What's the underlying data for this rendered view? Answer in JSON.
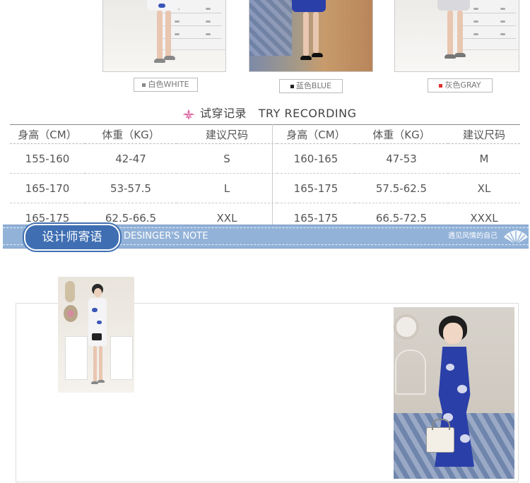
{
  "colors": {
    "white_dress": "#f4f4f6",
    "blue_dress": "#2a3fa8",
    "gray_dress": "#d9d9dd",
    "banner": "#92b2d8",
    "pill": "#3f6fb2",
    "fleur": "#e06aa6"
  },
  "swatches": [
    {
      "label": "白色WHITE",
      "dot_color": "#888888"
    },
    {
      "label": "蓝色BLUE",
      "dot_color": "#222222"
    },
    {
      "label": "灰色GRAY",
      "dot_color": "#e03030"
    }
  ],
  "try_recording": {
    "icon": "fleur-de-lis-icon",
    "title": "试穿记录   TRY RECORDING"
  },
  "size_table": {
    "headers": [
      "身高（CM）",
      "体重（KG）",
      "建议尺码",
      "身高（CM）",
      "体重（KG）",
      "建议尺码"
    ],
    "rows": [
      [
        "155-160",
        "42-47",
        "S",
        "160-165",
        "47-53",
        "M"
      ],
      [
        "165-170",
        "53-57.5",
        "L",
        "165-175",
        "57.5-62.5",
        "XL"
      ],
      [
        "165-175",
        "62.5-66.5",
        "XXL",
        "165-175",
        "66.5-72.5",
        "XXXL"
      ]
    ]
  },
  "designer_note": {
    "pill_label": "设计师寄语",
    "note_label": "DESINGER'S NOTE",
    "slogan": "遇见风情的自己",
    "icon": "shell-icon"
  }
}
